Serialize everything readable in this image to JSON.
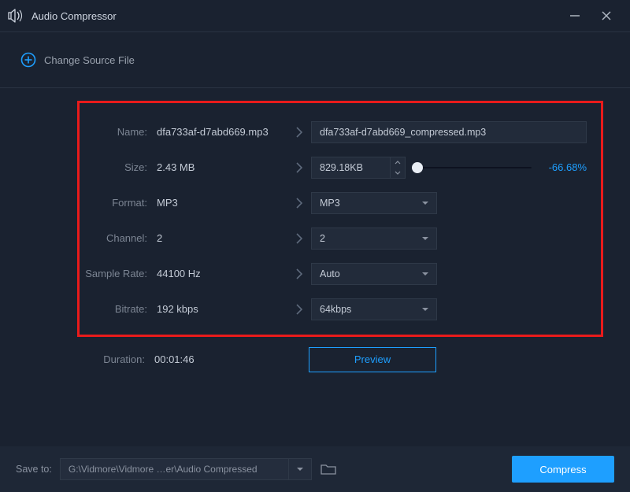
{
  "app": {
    "title": "Audio Compressor"
  },
  "subheader": {
    "change_source": "Change Source File"
  },
  "labels": {
    "name": "Name:",
    "size": "Size:",
    "format": "Format:",
    "channel": "Channel:",
    "sample_rate": "Sample Rate:",
    "bitrate": "Bitrate:",
    "duration": "Duration:"
  },
  "source": {
    "name": "dfa733af-d7abd669.mp3",
    "size": "2.43 MB",
    "format": "MP3",
    "channel": "2",
    "sample_rate": "44100 Hz",
    "bitrate": "192 kbps"
  },
  "target": {
    "name": "dfa733af-d7abd669_compressed.mp3",
    "size": "829.18KB",
    "size_pct": "-66.68%",
    "format": "MP3",
    "channel": "2",
    "sample_rate": "Auto",
    "bitrate": "64kbps"
  },
  "duration": "00:01:46",
  "buttons": {
    "preview": "Preview",
    "compress": "Compress"
  },
  "footer": {
    "save_to_label": "Save to:",
    "save_path": "G:\\Vidmore\\Vidmore …er\\Audio Compressed"
  },
  "colors": {
    "accent": "#1e9fff",
    "highlight_box": "#e91b1b",
    "bg": "#1a2230"
  }
}
